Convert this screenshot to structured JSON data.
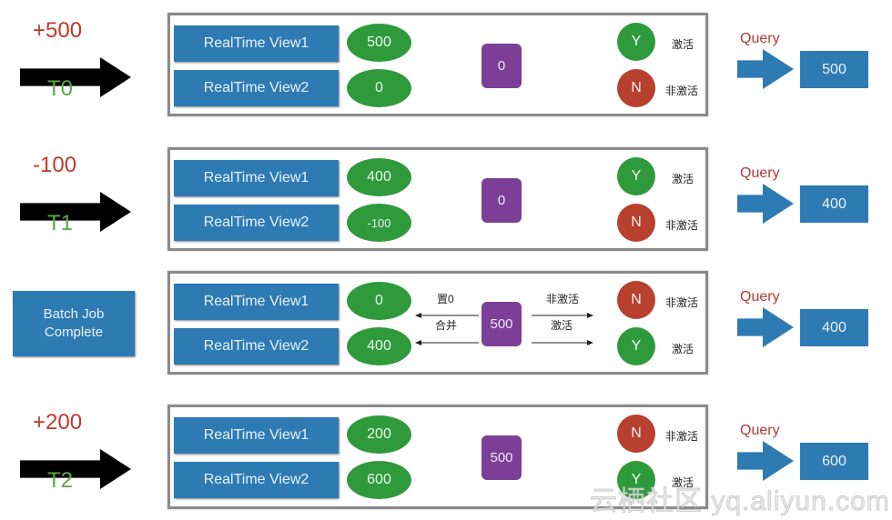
{
  "rows": [
    {
      "delta": "+500",
      "time": "T0",
      "views": [
        "RealTime View1",
        "RealTime View2"
      ],
      "values": [
        "500",
        "0"
      ],
      "batch": "0",
      "flags": [
        {
          "letter": "Y",
          "label": "激活"
        },
        {
          "letter": "N",
          "label": "非激活"
        }
      ],
      "query": "Query",
      "result": "500"
    },
    {
      "delta": "-100",
      "time": "T1",
      "views": [
        "RealTime View1",
        "RealTime View2"
      ],
      "values": [
        "400",
        "-100"
      ],
      "batch": "0",
      "flags": [
        {
          "letter": "Y",
          "label": "激活"
        },
        {
          "letter": "N",
          "label": "非激活"
        }
      ],
      "query": "Query",
      "result": "400"
    },
    {
      "batch_job": "Batch Job Complete",
      "views": [
        "RealTime View1",
        "RealTime View2"
      ],
      "values": [
        "0",
        "400"
      ],
      "batch": "500",
      "flags": [
        {
          "letter": "N",
          "label": "非激活"
        },
        {
          "letter": "Y",
          "label": "激活"
        }
      ],
      "arrow_labels": {
        "reset": "置0",
        "merge": "合并",
        "deactivate": "非激活",
        "activate": "激活"
      },
      "query": "Query",
      "result": "400"
    },
    {
      "delta": "+200",
      "time": "T2",
      "views": [
        "RealTime View1",
        "RealTime View2"
      ],
      "values": [
        "200",
        "600"
      ],
      "batch": "500",
      "flags": [
        {
          "letter": "N",
          "label": "非激活"
        },
        {
          "letter": "Y",
          "label": "激活"
        }
      ],
      "query": "Query",
      "result": "600"
    }
  ],
  "colors": {
    "view": "#2e7bb4",
    "value": "#2f9a3c",
    "batch": "#7b3f98",
    "active": "#2f9a3c",
    "inactive": "#b8402e",
    "delta": "#c0392b",
    "time": "#5aa845",
    "query": "#b03a3a"
  },
  "watermark": "云栖社区 yq.aliyun.com"
}
